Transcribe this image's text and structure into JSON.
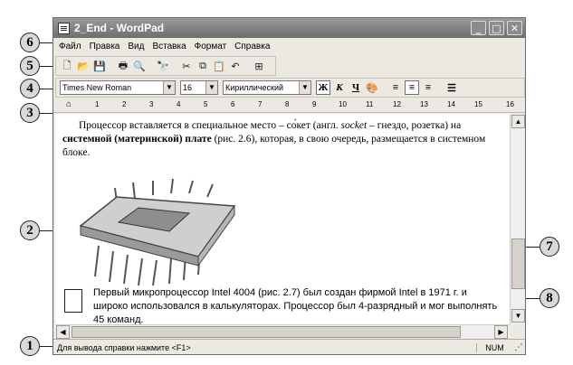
{
  "window": {
    "title": "2_End - WordPad",
    "min_label": "_",
    "max_label": "□",
    "close_label": "✕"
  },
  "menu": [
    "Файл",
    "Правка",
    "Вид",
    "Вставка",
    "Формат",
    "Справка"
  ],
  "format": {
    "font": "Times New Roman",
    "size": "16",
    "script": "Кириллический",
    "bold": "Ж",
    "italic": "К",
    "underline": "Ч"
  },
  "ruler": [
    "1",
    "2",
    "3",
    "4",
    "5",
    "6",
    "7",
    "8",
    "9",
    "10",
    "11",
    "12",
    "13",
    "14",
    "15",
    "16"
  ],
  "document": {
    "p1_start": "Процессор вставляется в специальное место – со́кет (англ. ",
    "p1_socket": "socket",
    "p1_mid": " – гнездо, розетка) на ",
    "p1_bold": "системной (материнской) плате",
    "p1_end": " (рис. 2.6), которая, в свою очередь, размещается в системном блоке.",
    "note": "Первый микропроцессор Intel 4004 (рис. 2.7) был создан фирмой Intel в 1971 г. и широко использовался в калькуляторах. Процессор был 4-разрядный и мог выполнять 45 команд."
  },
  "status": {
    "help": "Для вывода справки нажмите <F1>",
    "num": "NUM"
  },
  "callouts": [
    "1",
    "2",
    "3",
    "4",
    "5",
    "6",
    "7",
    "8"
  ]
}
